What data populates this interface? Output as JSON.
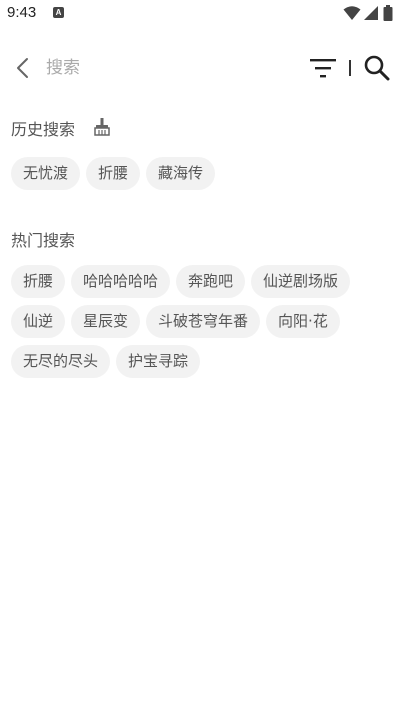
{
  "status_bar": {
    "time": "9:43",
    "badge": "A",
    "icons": [
      "wifi-icon",
      "signal-icon",
      "battery-icon"
    ]
  },
  "search": {
    "placeholder": "搜索",
    "value": ""
  },
  "history": {
    "title": "历史搜索",
    "items": [
      "无忧渡",
      "折腰",
      "藏海传"
    ]
  },
  "hot": {
    "title": "热门搜索",
    "items": [
      "折腰",
      "哈哈哈哈哈",
      "奔跑吧",
      "仙逆剧场版",
      "仙逆",
      "星辰变",
      "斗破苍穹年番",
      "向阳·花",
      "无尽的尽头",
      "护宝寻踪"
    ]
  },
  "colors": {
    "tag_background": "#f2f2f2",
    "text": "#555555",
    "placeholder": "#aaaaaa"
  }
}
